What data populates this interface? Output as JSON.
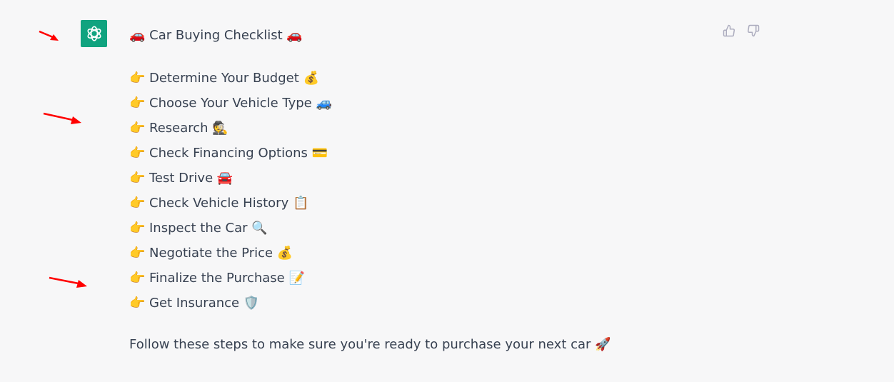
{
  "message": {
    "title": {
      "prefix_emoji": "🚗",
      "text": "Car Buying Checklist",
      "suffix_emoji": "🚗"
    },
    "checklist": [
      {
        "bullet": "👉",
        "text": "Determine Your Budget",
        "emoji": "💰"
      },
      {
        "bullet": "👉",
        "text": "Choose Your Vehicle Type",
        "emoji": "🚙"
      },
      {
        "bullet": "👉",
        "text": "Research",
        "emoji": "🕵️"
      },
      {
        "bullet": "👉",
        "text": "Check Financing Options",
        "emoji": "💳"
      },
      {
        "bullet": "👉",
        "text": "Test Drive",
        "emoji": "🚘"
      },
      {
        "bullet": "👉",
        "text": "Check Vehicle History",
        "emoji": "📋"
      },
      {
        "bullet": "👉",
        "text": "Inspect the Car",
        "emoji": "🔍"
      },
      {
        "bullet": "👉",
        "text": "Negotiate the Price",
        "emoji": "💰"
      },
      {
        "bullet": "👉",
        "text": "Finalize the Purchase",
        "emoji": "📝"
      },
      {
        "bullet": "👉",
        "text": "Get Insurance",
        "emoji": "🛡️"
      }
    ],
    "footer": {
      "text": "Follow these steps to make sure you're ready to purchase your next car",
      "emoji": "🚀"
    }
  },
  "avatar": {
    "icon": "openai-logo-icon",
    "color": "#10a37f"
  },
  "feedback": {
    "thumbs_up": "thumbs-up-icon",
    "thumbs_down": "thumbs-down-icon"
  },
  "annotations": {
    "arrow_color": "#ff0000"
  }
}
